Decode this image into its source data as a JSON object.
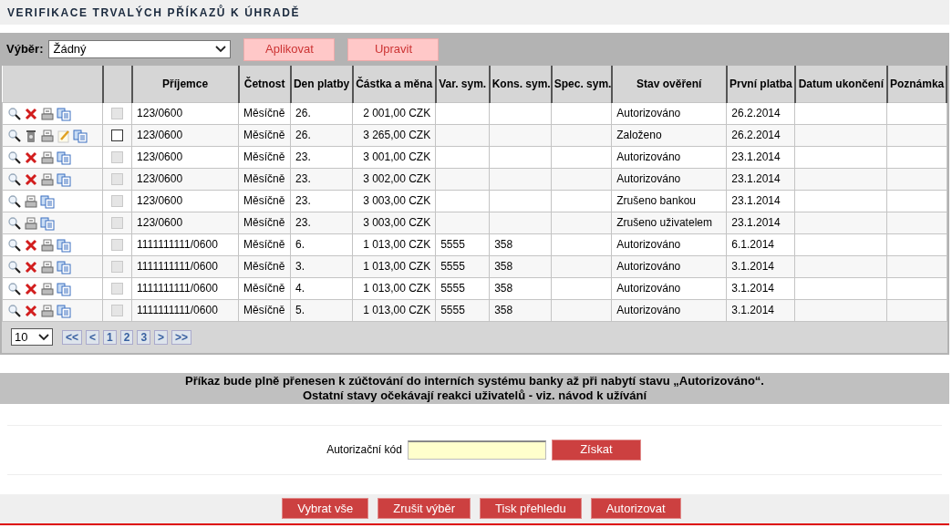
{
  "title": "VERIFIKACE TRVALÝCH PŘÍKAZŮ K ÚHRADĚ",
  "toolbar": {
    "label": "Výběr:",
    "select_value": "Žádný",
    "buttons": [
      "Aplikovat",
      "Upravit"
    ]
  },
  "table": {
    "columns": [
      "Příjemce",
      "Četnost",
      "Den platby",
      "Částka a měna",
      "Var. sym.",
      "Kons. sym.",
      "Spec. sym.",
      "Stav ověření",
      "První platba",
      "Datum ukončení",
      "Poznámka"
    ],
    "rows": [
      {
        "actions": [
          {
            "kind": "view"
          },
          {
            "kind": "delete"
          },
          {
            "kind": "print"
          },
          {
            "kind": "copy"
          }
        ],
        "checkbox_disabled": true,
        "checked": false,
        "recipient": "123/0600",
        "frequency": "Měsíčně",
        "day": "26.",
        "amount": "2 001,00 CZK",
        "status": "Autorizováno",
        "first_payment": "26.2.2014"
      },
      {
        "actions": [
          {
            "kind": "view"
          },
          {
            "kind": "trash"
          },
          {
            "kind": "print"
          },
          {
            "kind": "edit"
          },
          {
            "kind": "copy"
          }
        ],
        "checkbox_disabled": false,
        "checked": false,
        "recipient": "123/0600",
        "frequency": "Měsíčně",
        "day": "26.",
        "amount": "3 265,00 CZK",
        "status": "Založeno",
        "first_payment": "26.2.2014"
      },
      {
        "actions": [
          {
            "kind": "view"
          },
          {
            "kind": "delete"
          },
          {
            "kind": "print"
          },
          {
            "kind": "copy"
          }
        ],
        "checkbox_disabled": true,
        "checked": false,
        "recipient": "123/0600",
        "frequency": "Měsíčně",
        "day": "23.",
        "amount": "3 001,00 CZK",
        "status": "Autorizováno",
        "first_payment": "23.1.2014"
      },
      {
        "actions": [
          {
            "kind": "view"
          },
          {
            "kind": "delete"
          },
          {
            "kind": "print"
          },
          {
            "kind": "copy"
          }
        ],
        "checkbox_disabled": true,
        "checked": false,
        "recipient": "123/0600",
        "frequency": "Měsíčně",
        "day": "23.",
        "amount": "3 002,00 CZK",
        "status": "Autorizováno",
        "first_payment": "23.1.2014"
      },
      {
        "actions": [
          {
            "kind": "view"
          },
          {
            "kind": "print"
          },
          {
            "kind": "copy"
          }
        ],
        "checkbox_disabled": true,
        "checked": false,
        "recipient": "123/0600",
        "frequency": "Měsíčně",
        "day": "23.",
        "amount": "3 003,00 CZK",
        "status": "Zrušeno bankou",
        "first_payment": "23.1.2014"
      },
      {
        "actions": [
          {
            "kind": "view"
          },
          {
            "kind": "print"
          },
          {
            "kind": "copy"
          }
        ],
        "checkbox_disabled": true,
        "checked": false,
        "recipient": "123/0600",
        "frequency": "Měsíčně",
        "day": "23.",
        "amount": "3 003,00 CZK",
        "status": "Zrušeno uživatelem",
        "first_payment": "23.1.2014"
      },
      {
        "actions": [
          {
            "kind": "view"
          },
          {
            "kind": "delete"
          },
          {
            "kind": "print"
          },
          {
            "kind": "copy"
          }
        ],
        "checkbox_disabled": true,
        "checked": false,
        "recipient": "1111111111/0600",
        "frequency": "Měsíčně",
        "day": "6.",
        "amount": "1 013,00 CZK",
        "var_sym": "5555",
        "const_sym": "358",
        "status": "Autorizováno",
        "first_payment": "6.1.2014"
      },
      {
        "actions": [
          {
            "kind": "view"
          },
          {
            "kind": "delete"
          },
          {
            "kind": "print"
          },
          {
            "kind": "copy"
          }
        ],
        "checkbox_disabled": true,
        "checked": false,
        "recipient": "1111111111/0600",
        "frequency": "Měsíčně",
        "day": "3.",
        "amount": "1 013,00 CZK",
        "var_sym": "5555",
        "const_sym": "358",
        "status": "Autorizováno",
        "first_payment": "3.1.2014"
      },
      {
        "actions": [
          {
            "kind": "view"
          },
          {
            "kind": "delete"
          },
          {
            "kind": "print"
          },
          {
            "kind": "copy"
          }
        ],
        "checkbox_disabled": true,
        "checked": false,
        "recipient": "1111111111/0600",
        "frequency": "Měsíčně",
        "day": "4.",
        "amount": "1 013,00 CZK",
        "var_sym": "5555",
        "const_sym": "358",
        "status": "Autorizováno",
        "first_payment": "3.1.2014"
      },
      {
        "actions": [
          {
            "kind": "view"
          },
          {
            "kind": "delete"
          },
          {
            "kind": "print"
          },
          {
            "kind": "copy"
          }
        ],
        "checkbox_disabled": true,
        "checked": false,
        "recipient": "1111111111/0600",
        "frequency": "Měsíčně",
        "day": "5.",
        "amount": "1 013,00 CZK",
        "var_sym": "5555",
        "const_sym": "358",
        "status": "Autorizováno",
        "first_payment": "3.1.2014"
      }
    ]
  },
  "pager": {
    "page_size": "10",
    "links": [
      "<<",
      "<",
      "1",
      "2",
      "3",
      ">",
      ">>"
    ]
  },
  "notice": [
    "Příkaz bude plně přenesen k zúčtování do interních systému banky až při nabytí stavu „Autorizováno“.",
    "Ostatní stavy očekávají reakci uživatelů - viz. návod k užívání"
  ],
  "auth": {
    "label": "Autorizační kód",
    "button": "Získat"
  },
  "footer_buttons": [
    "Vybrat vše",
    "Zrušit výběr",
    "Tisk přehledu",
    "Autorizovat"
  ]
}
